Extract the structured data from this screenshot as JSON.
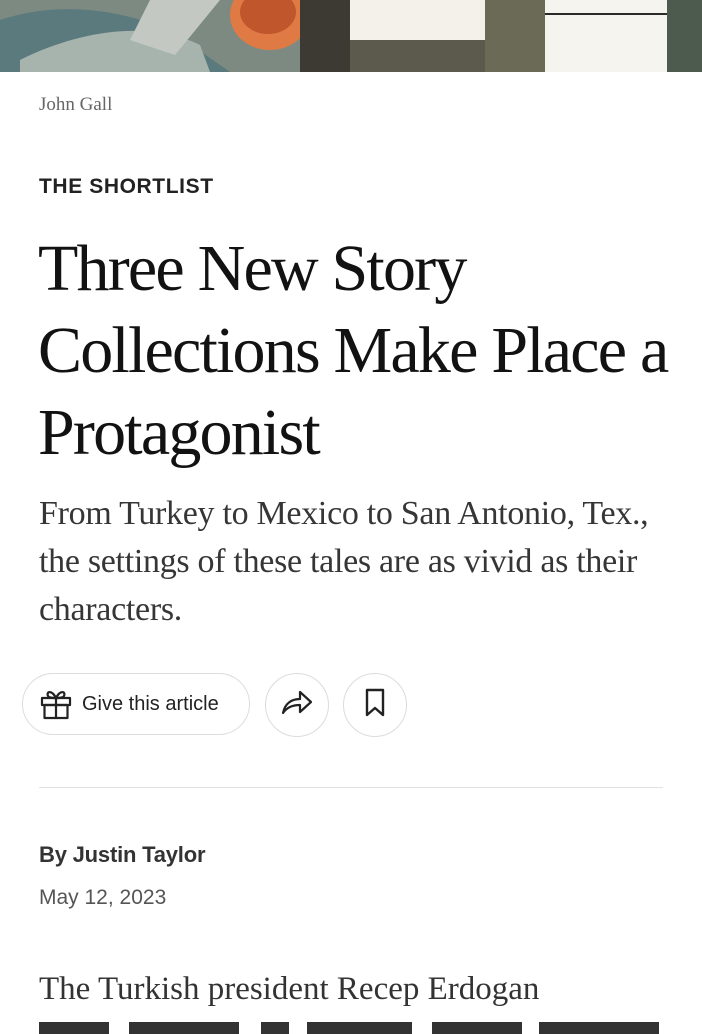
{
  "article": {
    "image_credit": "John Gall",
    "kicker": "THE SHORTLIST",
    "headline": "Three New Story Collections Make Place a Protagonist",
    "summary": "From Turkey to Mexico to San Antonio, Tex., the settings of these tales are as vivid as their characters.",
    "byline": "By Justin Taylor",
    "date": "May 12, 2023",
    "body_first_line": "The Turkish president Recep Erdogan"
  },
  "actions": {
    "gift_label": "Give this article",
    "gift_icon": "gift-icon",
    "share_icon": "share-icon",
    "save_icon": "bookmark-icon"
  },
  "colors": {
    "text": "#121212",
    "muted": "#666666",
    "border": "#dcdcdc"
  }
}
